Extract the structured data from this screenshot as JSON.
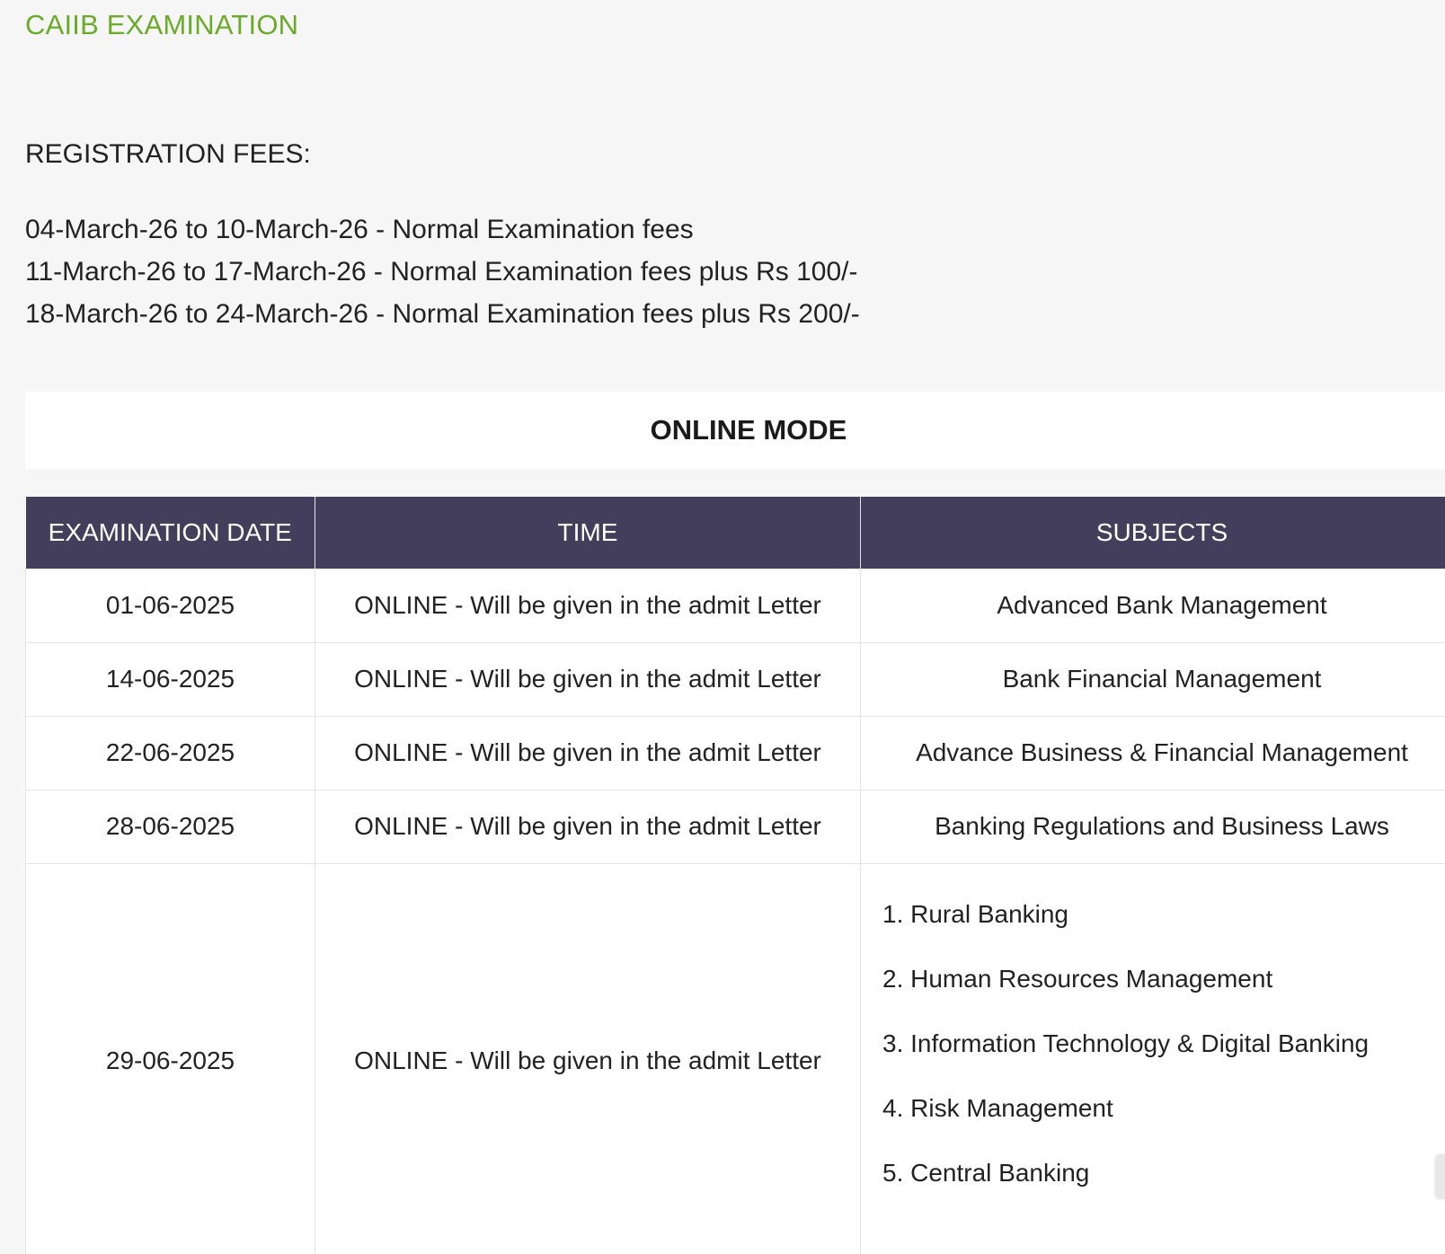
{
  "exam_title": "CAIIB EXAMINATION",
  "fees": {
    "heading": "REGISTRATION FEES:",
    "items": [
      "04-March-26 to 10-March-26 - Normal Examination fees",
      "11-March-26 to 17-March-26 - Normal Examination fees plus Rs 100/-",
      "18-March-26 to 24-March-26 - Normal Examination fees plus Rs 200/-"
    ]
  },
  "mode_banner": "ONLINE MODE",
  "table": {
    "headers": [
      "EXAMINATION DATE",
      "TIME",
      "SUBJECTS"
    ],
    "rows": [
      {
        "date": "01-06-2025",
        "time": "ONLINE - Will be given in the admit Letter",
        "subject": "Advanced Bank Management"
      },
      {
        "date": "14-06-2025",
        "time": "ONLINE - Will be given in the admit Letter",
        "subject": "Bank Financial Management"
      },
      {
        "date": "22-06-2025",
        "time": "ONLINE - Will be given in the admit Letter",
        "subject": "Advance Business & Financial Management"
      },
      {
        "date": "28-06-2025",
        "time": "ONLINE - Will be given in the admit Letter",
        "subject": "Banking Regulations and Business Laws"
      }
    ],
    "elective_row": {
      "date": "29-06-2025",
      "time": "ONLINE - Will be given in the admit Letter",
      "subjects": [
        "1. Rural Banking",
        "2. Human Resources Management",
        "3. Information Technology & Digital Banking",
        "4. Risk Management",
        "5. Central Banking"
      ]
    }
  },
  "colors": {
    "title_green": "#6aab2a",
    "header_bg": "#433e5c",
    "page_bg": "#f6f6f6"
  }
}
